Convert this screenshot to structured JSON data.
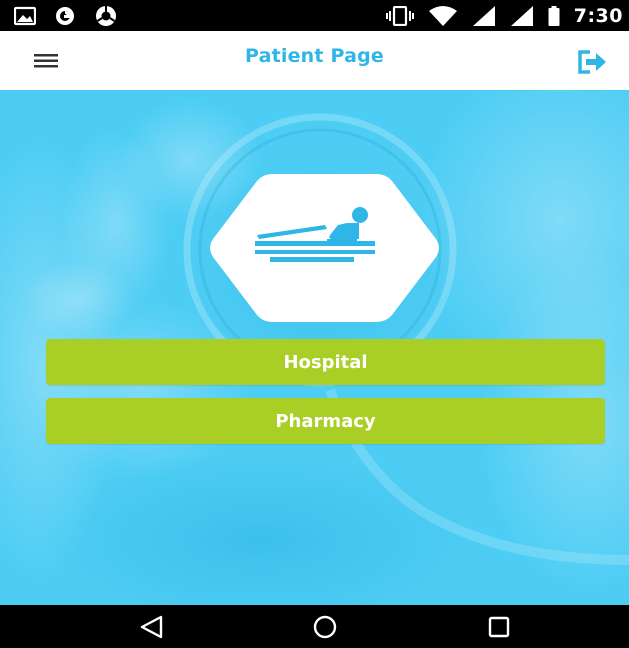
{
  "status_bar": {
    "time": "7:30",
    "left_icons": [
      "image-icon",
      "sync-icon",
      "chrome-icon"
    ],
    "right_icons": [
      "vibrate-icon",
      "wifi-icon",
      "signal-icon",
      "signal-icon",
      "battery-icon"
    ]
  },
  "app_bar": {
    "title": "Patient Page",
    "menu_icon": "hamburger-menu-icon",
    "logout_icon": "logout-icon"
  },
  "hero": {
    "badge_icon": "hospital-bed-icon",
    "colors": {
      "background": "#4ecdf4",
      "title": "#2fb6e6",
      "button": "#a9cf26"
    }
  },
  "buttons": {
    "hospital_label": "Hospital",
    "pharmacy_label": "Pharmacy"
  },
  "nav_bar": {
    "icons": [
      "back-icon",
      "home-icon",
      "recents-icon"
    ]
  }
}
